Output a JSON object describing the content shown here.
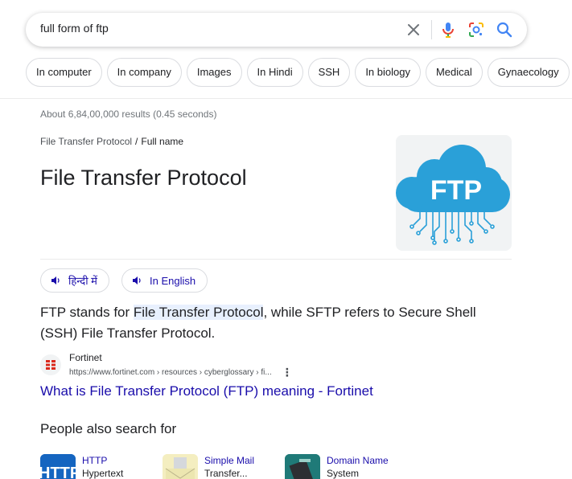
{
  "search": {
    "query": "full form of ftp"
  },
  "chips": [
    "In computer",
    "In company",
    "Images",
    "In Hindi",
    "SSH",
    "In biology",
    "Medical",
    "Gynaecology"
  ],
  "result_stats": "About 6,84,00,000 results (0.45 seconds)",
  "breadcrumb": {
    "parent": "File Transfer Protocol",
    "separator": "/",
    "current": "Full name"
  },
  "answer": {
    "title": "File Transfer Protocol",
    "image_text": "FTP"
  },
  "language_buttons": {
    "hindi": "हिन्दी में",
    "english": "In English"
  },
  "snippet": {
    "before": "FTP stands for ",
    "highlight": "File Transfer Protocol",
    "after": ", while SFTP refers to Secure Shell (SSH) File Transfer Protocol."
  },
  "source": {
    "name": "Fortinet",
    "url": "https://www.fortinet.com › resources › cyberglossary › fi...",
    "link_title": "What is File Transfer Protocol (FTP) meaning - Fortinet"
  },
  "people_also_search": {
    "title": "People also search for",
    "items": [
      {
        "line1": "HTTP",
        "line2": "Hypertext",
        "thumb_text": "HTTP"
      },
      {
        "line1": "Simple Mail",
        "line2": "Transfer..."
      },
      {
        "line1": "Domain Name",
        "line2": "System"
      }
    ]
  },
  "colors": {
    "link": "#1a0dab",
    "ftp_cloud": "#2aa0d8",
    "highlight": "#e8f0fe"
  }
}
